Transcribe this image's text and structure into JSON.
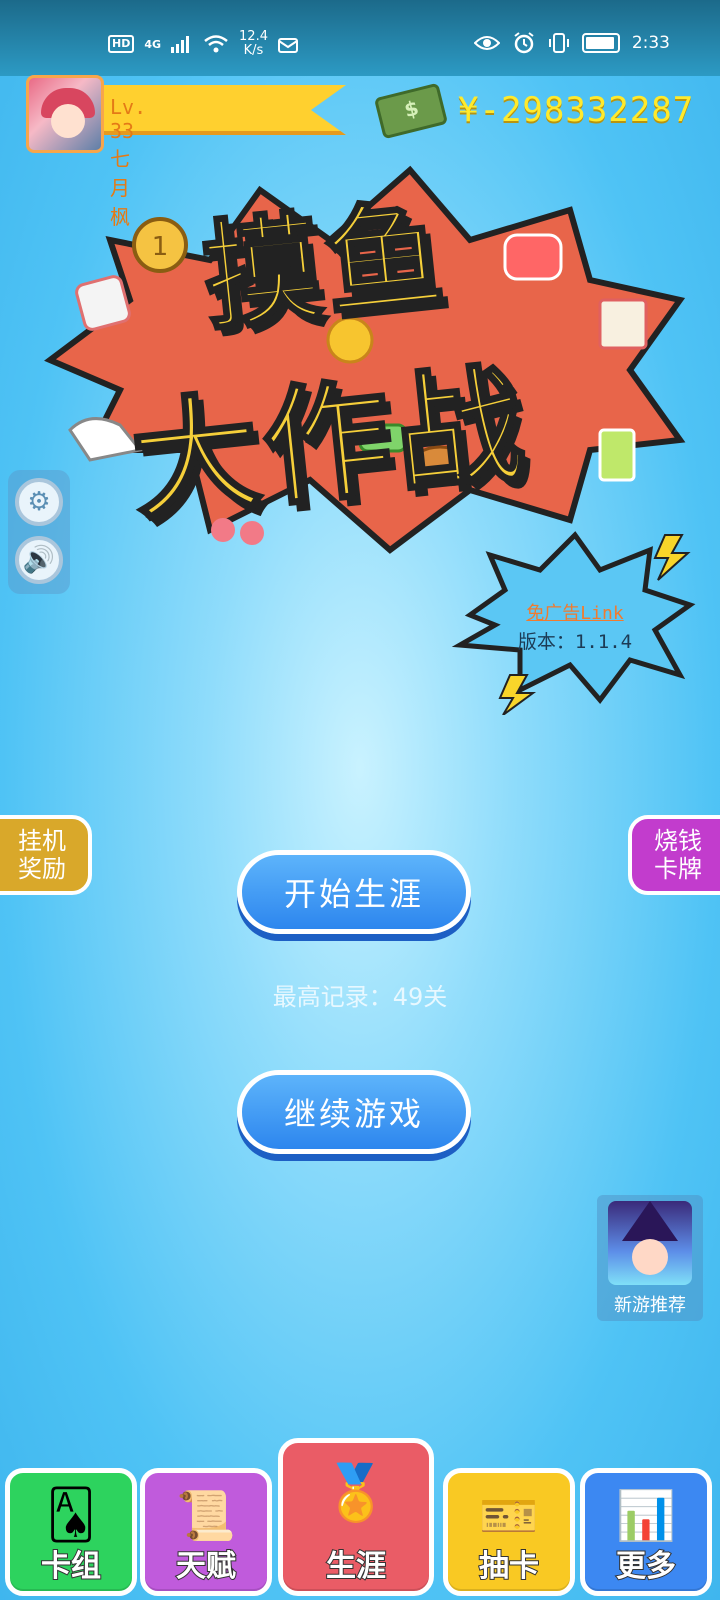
{
  "status_bar": {
    "network_hd": "HD",
    "network_4g": "4G",
    "speed_value": "12.4",
    "speed_unit": "K/s",
    "time": "2:33"
  },
  "player": {
    "level_name": "Lv. 33 七月枫",
    "money": "¥-298332287"
  },
  "logo": {
    "title_line1": "摸鱼",
    "title_line2": "大作战"
  },
  "badge": {
    "link": "免广告Link",
    "version": "版本：1.1.4"
  },
  "side_tabs": {
    "left": "挂机\n奖励",
    "right": "烧钱\n卡牌"
  },
  "buttons": {
    "start": "开始生涯",
    "record": "最高记录：49关",
    "continue": "继续游戏"
  },
  "promo": {
    "label": "新游推荐"
  },
  "nav": {
    "cards": "卡组",
    "talent": "天赋",
    "career": "生涯",
    "draw": "抽卡",
    "more": "更多"
  },
  "colors": {
    "background": "#4fc3f5",
    "money": "#ffea2c",
    "ribbon": "#ffd02f",
    "button": "#2d86ee"
  }
}
